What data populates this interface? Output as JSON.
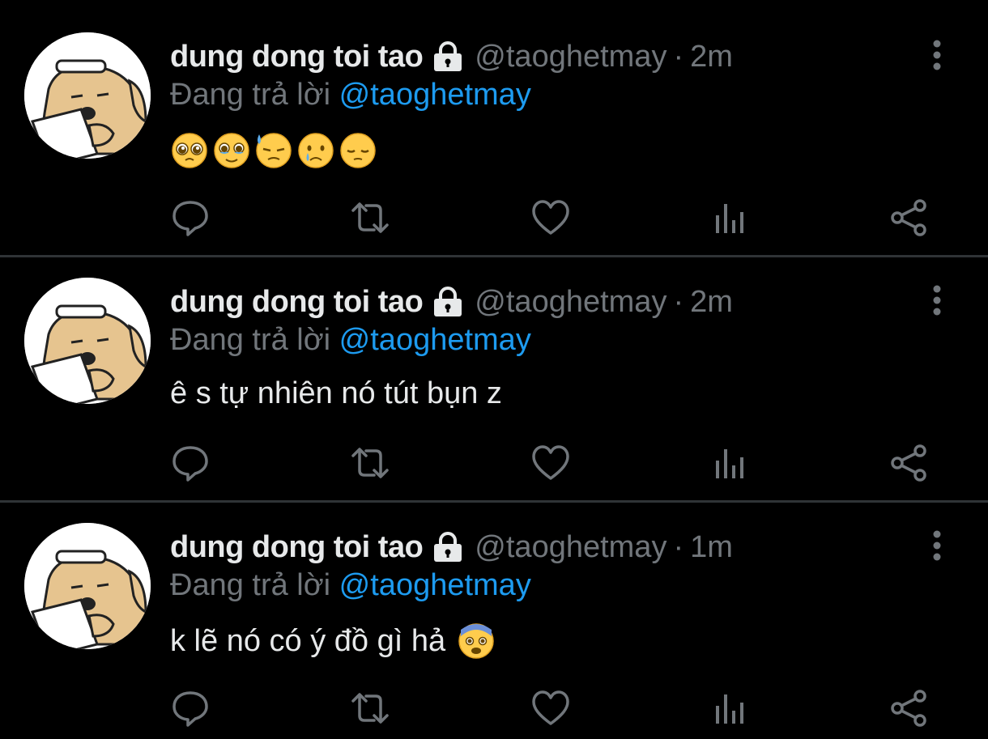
{
  "tweets": [
    {
      "display_name": "dung dong toi tao",
      "handle": "@taoghetmay",
      "separator": "·",
      "time": "2m",
      "reply_prefix": "Đang trả lời",
      "reply_to": "@taoghetmay",
      "text": "",
      "emojis": [
        "pleading-face",
        "face-holding-back-tears",
        "downcast-face-with-sweat",
        "crying-face",
        "pensive-face"
      ]
    },
    {
      "display_name": "dung dong toi tao",
      "handle": "@taoghetmay",
      "separator": "·",
      "time": "2m",
      "reply_prefix": "Đang trả lời",
      "reply_to": "@taoghetmay",
      "text": "ê s tự nhiên nó tút bụn z",
      "emojis": []
    },
    {
      "display_name": "dung dong toi tao",
      "handle": "@taoghetmay",
      "separator": "·",
      "time": "1m",
      "reply_prefix": "Đang trả lời",
      "reply_to": "@taoghetmay",
      "text": "k lẽ nó có ý đồ gì hả",
      "emojis": [
        "anxious-face"
      ]
    }
  ],
  "actions": [
    "reply-icon",
    "retweet-icon",
    "like-icon",
    "views-icon",
    "share-icon"
  ],
  "colors": {
    "background": "#000000",
    "primary_text": "#e7e9ea",
    "secondary_text": "#71767b",
    "mention": "#1d9bf0",
    "divider": "#2f3336"
  }
}
